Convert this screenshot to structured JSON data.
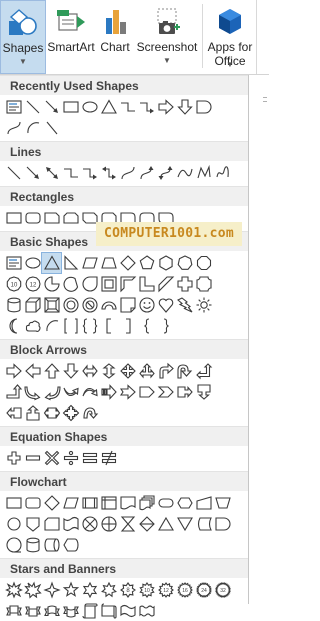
{
  "ribbon": {
    "shapes": {
      "label": "Shapes",
      "icon": "shapes-icon"
    },
    "smartart": {
      "label": "SmartArt",
      "icon": "smartart-icon"
    },
    "chart": {
      "label": "Chart",
      "icon": "chart-icon"
    },
    "screenshot": {
      "label": "Screenshot",
      "icon": "screenshot-icon"
    },
    "apps": {
      "label_line1": "Apps for",
      "label_line2": "Office",
      "icon": "apps-for-office-icon"
    }
  },
  "watermark": "COMPUTER1001.com",
  "sections": [
    {
      "title": "Recently Used Shapes",
      "rows": [
        [
          "text-box",
          "line",
          "line-arrow",
          "rectangle",
          "oval",
          "triangle",
          "elbow-connector",
          "elbow-arrow",
          "right-arrow",
          "down-arrow",
          "flowchart-delay"
        ],
        [
          "curved-connector",
          "arc",
          "line-diagonal"
        ]
      ]
    },
    {
      "title": "Lines",
      "rows": [
        [
          "line",
          "line-arrow",
          "line-double-arrow",
          "elbow-connector",
          "elbow-arrow",
          "elbow-double-arrow",
          "curved-connector",
          "curved-arrow",
          "curved-double-arrow",
          "curve",
          "freeform",
          "scribble"
        ]
      ]
    },
    {
      "title": "Rectangles",
      "rows": [
        [
          "rectangle",
          "rounded-rectangle",
          "snip-single-corner",
          "snip-same-side",
          "snip-diagonal",
          "snip-round",
          "round-single-corner",
          "round-same-side",
          "round-diagonal"
        ]
      ]
    },
    {
      "title": "Basic Shapes",
      "rows": [
        [
          "text-box",
          "oval",
          "isosceles-triangle",
          "right-triangle",
          "parallelogram",
          "trapezoid",
          "diamond",
          "pentagon",
          "hexagon",
          "heptagon",
          "octagon"
        ],
        [
          "decagon",
          "dodecagon",
          "pie",
          "chord",
          "teardrop",
          "frame",
          "half-frame",
          "l-shape",
          "diagonal-stripe",
          "plus",
          "plaque"
        ],
        [
          "can",
          "cube",
          "bevel",
          "donut",
          "no-symbol",
          "block-arc",
          "folded-corner",
          "smiley-face",
          "heart",
          "lightning-bolt",
          "sun"
        ],
        [
          "moon",
          "cloud",
          "arc",
          "double-bracket",
          "double-brace",
          "left-bracket",
          "right-bracket",
          "left-brace",
          "right-brace"
        ]
      ]
    },
    {
      "title": "Block Arrows",
      "rows": [
        [
          "right-arrow",
          "left-arrow",
          "up-arrow",
          "down-arrow",
          "left-right-arrow",
          "up-down-arrow",
          "quad-arrow",
          "left-right-up-arrow",
          "bent-arrow",
          "u-turn-arrow",
          "left-up-arrow"
        ],
        [
          "bent-up-arrow",
          "curved-right-arrow",
          "curved-left-arrow",
          "curved-up-arrow",
          "curved-down-arrow",
          "striped-right-arrow",
          "notched-right-arrow",
          "pentagon-arrow",
          "chevron",
          "right-arrow-callout",
          "down-arrow-callout"
        ],
        [
          "left-arrow-callout",
          "up-arrow-callout",
          "left-right-arrow-callout",
          "quad-arrow-callout",
          "circular-arrow"
        ]
      ]
    },
    {
      "title": "Equation Shapes",
      "rows": [
        [
          "plus-sign",
          "minus-sign",
          "multiply-sign",
          "division-sign",
          "equal-sign",
          "not-equal-sign"
        ]
      ]
    },
    {
      "title": "Flowchart",
      "rows": [
        [
          "process",
          "alternate-process",
          "decision",
          "data",
          "predefined-process",
          "internal-storage",
          "document",
          "multidocument",
          "terminator",
          "preparation",
          "manual-input",
          "manual-operation"
        ],
        [
          "connector",
          "off-page-connector",
          "card",
          "punched-tape",
          "summing-junction",
          "or",
          "collate",
          "sort",
          "extract",
          "merge",
          "stored-data",
          "flowchart-delay"
        ],
        [
          "sequential-access-storage",
          "magnetic-disk",
          "direct-access-storage",
          "display"
        ]
      ]
    },
    {
      "title": "Stars and Banners",
      "rows": [
        [
          "explosion-1",
          "explosion-2",
          "star-4",
          "star-5",
          "star-6",
          "star-7",
          "star-8",
          "star-10",
          "star-12",
          "star-16",
          "star-24",
          "star-32"
        ],
        [
          "up-ribbon",
          "down-ribbon",
          "curved-up-ribbon",
          "curved-down-ribbon",
          "vertical-scroll",
          "horizontal-scroll",
          "wave",
          "double-wave"
        ]
      ]
    }
  ],
  "colors": {
    "accent": "#2b579a",
    "selected": "#c5dcef",
    "header_bg": "#f0f0f0",
    "stroke": "#3c3c3c"
  }
}
